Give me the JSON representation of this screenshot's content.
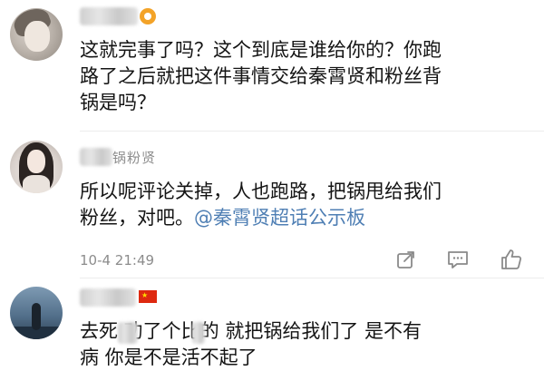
{
  "comments": [
    {
      "username": "",
      "avatar": "avatar",
      "text_lines": [
        "这就完事了吗？这个到底是谁给你的？你跑",
        "路了之后就把这件事情交给秦霄贤和粉丝背",
        "锅是吗？"
      ]
    },
    {
      "username": "锅粉贤",
      "avatar": "avatar",
      "text_lines": [
        "所以呢评论关掉，人也跑路，把锅甩给我们"
      ],
      "text_line2_prefix": "粉丝，对吧。",
      "mention": "@秦霄贤超话公示板",
      "timestamp": "10-4 21:49",
      "actions": [
        "share-icon",
        "comment-icon",
        "like-icon"
      ]
    },
    {
      "username": "",
      "avatar": "avatar",
      "text_lines": [
        "去死 劝了个比的 就把锅给我们了 是不有",
        "病 你是不是活不起了"
      ]
    }
  ],
  "colors": {
    "link": "#4f7fb4",
    "text": "#141414",
    "meta": "#8c8c8c",
    "badge": "#f3a328",
    "flag": "#de2910"
  }
}
